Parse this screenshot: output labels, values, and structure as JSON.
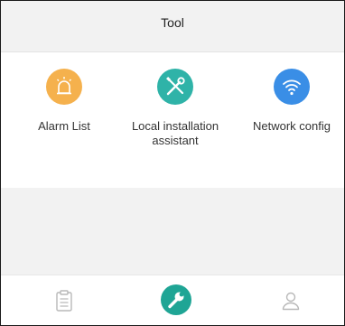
{
  "header": {
    "title": "Tool"
  },
  "tools": [
    {
      "label": "Alarm List",
      "icon": "alarm-siren-icon",
      "color": "#f5b14d"
    },
    {
      "label": "Local installation assistant",
      "icon": "wrench-screwdriver-icon",
      "color": "#2fb3a8"
    },
    {
      "label": "Network config",
      "icon": "wifi-icon",
      "color": "#3a8ee6"
    }
  ],
  "tabbar": {
    "items": [
      {
        "icon": "clipboard-list-icon",
        "active": false
      },
      {
        "icon": "wrench-icon",
        "active": true
      },
      {
        "icon": "user-icon",
        "active": false
      }
    ],
    "active_color": "#1fa595",
    "inactive_color": "#b8b8b8"
  }
}
